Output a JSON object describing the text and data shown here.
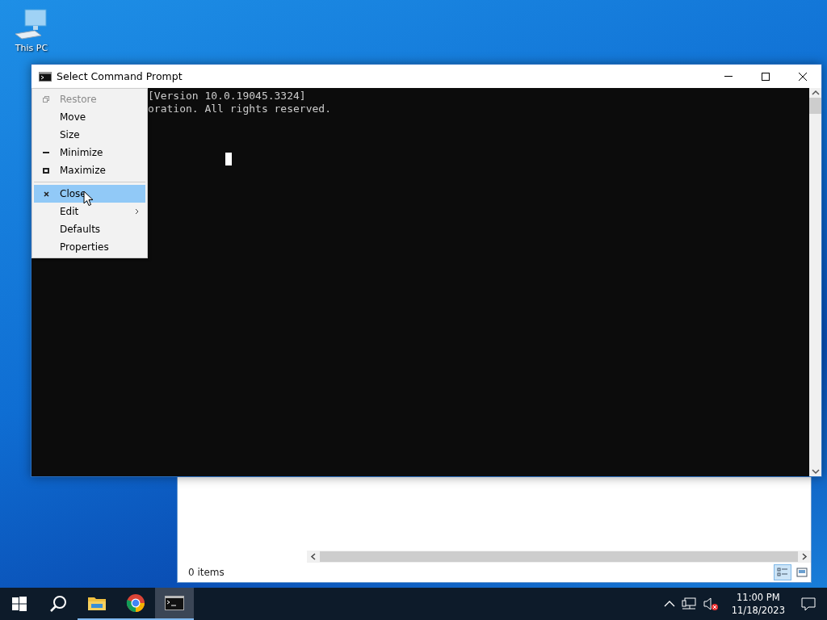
{
  "desktop_icons": [
    {
      "label": "This PC"
    }
  ],
  "explorer": {
    "status": "0 items",
    "views": [
      {
        "selected": true
      },
      {
        "selected": false
      }
    ]
  },
  "console": {
    "title": "Select Command Prompt",
    "lines": [
      "[Version 10.0.19045.3324]",
      "oration. All rights reserved."
    ]
  },
  "system_menu": {
    "items": [
      {
        "label": "Restore",
        "kind": "restore",
        "disabled": true,
        "selected": false
      },
      {
        "label": "Move",
        "kind": "plain",
        "disabled": false,
        "selected": false
      },
      {
        "label": "Size",
        "kind": "plain",
        "disabled": false,
        "selected": false
      },
      {
        "label": "Minimize",
        "kind": "minimize",
        "disabled": false,
        "selected": false
      },
      {
        "label": "Maximize",
        "kind": "maximize",
        "disabled": false,
        "selected": false
      },
      {
        "kind": "separator"
      },
      {
        "label": "Close",
        "kind": "close",
        "disabled": false,
        "selected": true
      },
      {
        "label": "Edit",
        "kind": "submenu",
        "disabled": false,
        "selected": false
      },
      {
        "label": "Defaults",
        "kind": "plain",
        "disabled": false,
        "selected": false
      },
      {
        "label": "Properties",
        "kind": "plain",
        "disabled": false,
        "selected": false
      }
    ]
  },
  "taskbar": {
    "apps": [
      {
        "kind": "explorer",
        "active": false
      },
      {
        "kind": "chrome",
        "active": false
      },
      {
        "kind": "console",
        "active": true
      }
    ],
    "time": "11:00 PM",
    "date": "11/18/2023"
  }
}
